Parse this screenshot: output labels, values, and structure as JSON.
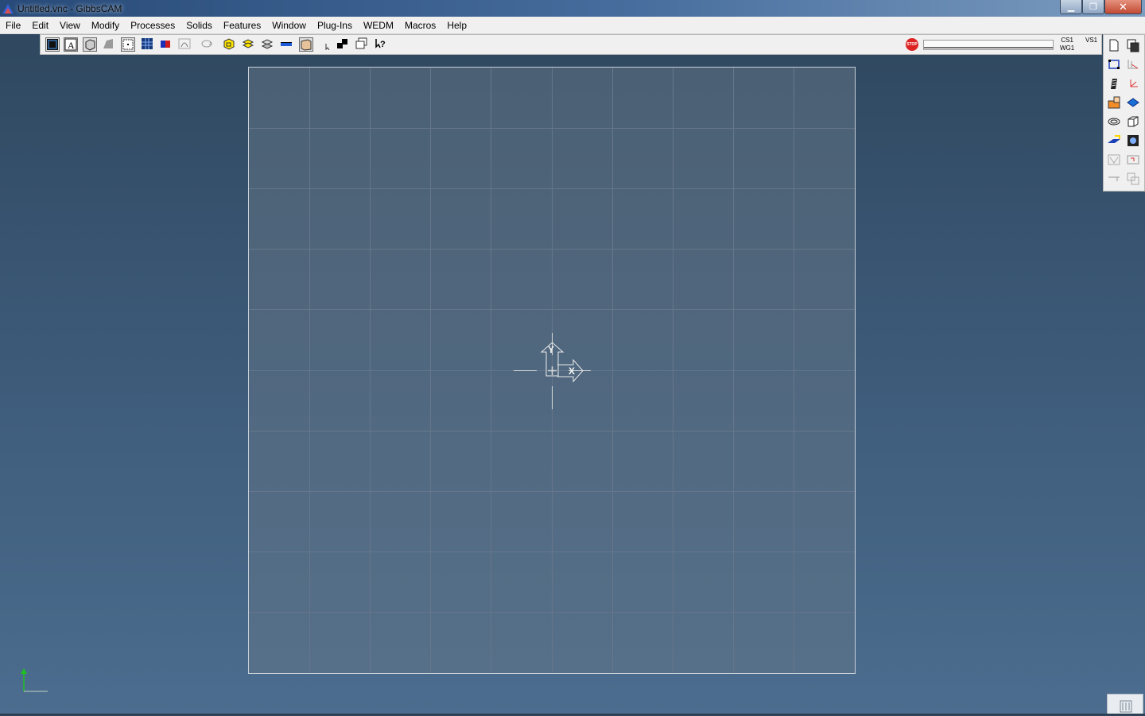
{
  "window": {
    "title": "Untitled.vnc - GibbsCAM",
    "minimize_glyph": "▁",
    "maximize_glyph": "❐",
    "close_glyph": "✕"
  },
  "menu": {
    "items": [
      "File",
      "Edit",
      "View",
      "Modify",
      "Processes",
      "Solids",
      "Features",
      "Window",
      "Plug-Ins",
      "WEDM",
      "Macros",
      "Help"
    ]
  },
  "toolbar": {
    "buttons": [
      "wireframe-view-icon",
      "text-icon",
      "shaded-box-icon",
      "surface-icon",
      "select-box-icon",
      "grid-select-icon",
      "magnet-icon",
      "curve-icon",
      "rotate-icon",
      "yellow-cube-icon",
      "yellow-layers-icon",
      "stacked-planes-icon",
      "blue-bar-icon",
      "solid-box-icon",
      "pointer-icon",
      "copy-objects-icon",
      "stacked-windows-icon",
      "help-icon"
    ],
    "stop_label": "STOP",
    "cs_label": "CS1",
    "wg_label": "WG1",
    "vs_label": "VS1"
  },
  "palette": {
    "buttons": [
      "new-doc-icon",
      "copy-doc-icon",
      "rectangle-icon",
      "axis-multi-icon",
      "drill-icon",
      "axis-red-icon",
      "shape-orange-icon",
      "plane-blue-icon",
      "surface-wireframe-icon",
      "box-outline-icon",
      "blue-plane-icon",
      "solid-cube-icon",
      "dimension-icon",
      "frame-icon",
      "line-icon",
      "overlap-icon"
    ]
  },
  "canvas": {
    "y_axis_label": "Y",
    "x_axis_label": "X"
  },
  "colors": {
    "grid_line": "#66768a",
    "axis_origin": "#dcdcdc",
    "indicator_green": "#20c020"
  }
}
